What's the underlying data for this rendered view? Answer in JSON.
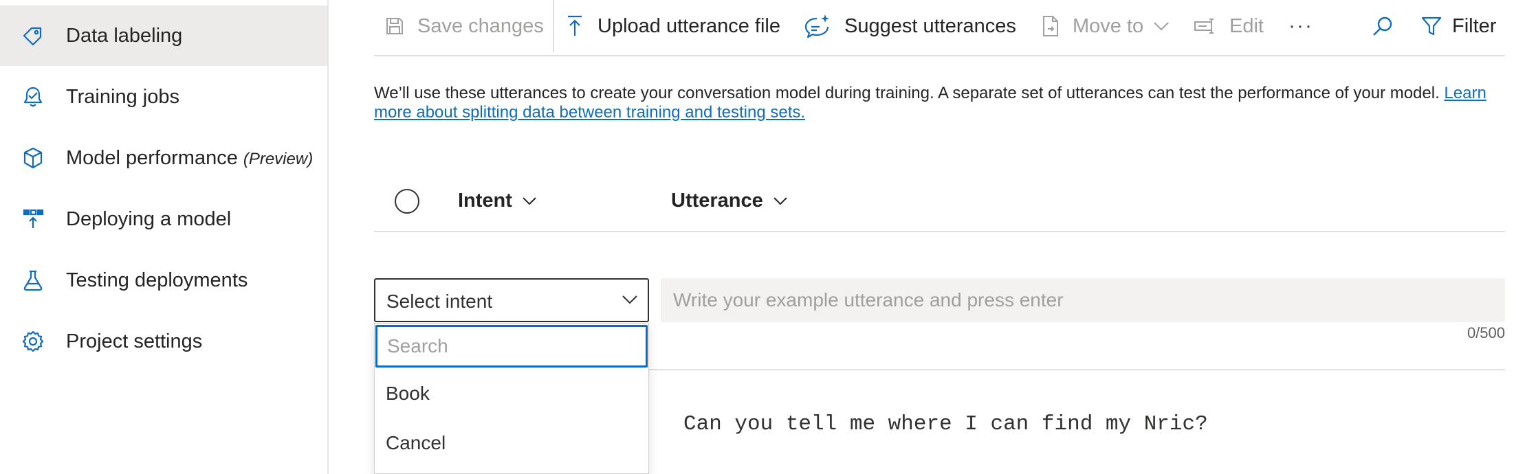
{
  "sidebar": {
    "items": [
      {
        "label": "Data labeling",
        "icon": "tag-icon",
        "active": true
      },
      {
        "label": "Training jobs",
        "icon": "training-icon"
      },
      {
        "label": "Model performance",
        "suffix": "(Preview)",
        "icon": "cube-icon"
      },
      {
        "label": "Deploying a model",
        "icon": "deploy-icon"
      },
      {
        "label": "Testing deployments",
        "icon": "flask-icon"
      },
      {
        "label": "Project settings",
        "icon": "gear-icon"
      }
    ]
  },
  "toolbar": {
    "save_label": "Save changes",
    "upload_label": "Upload utterance file",
    "suggest_label": "Suggest utterances",
    "move_label": "Move to",
    "edit_label": "Edit",
    "more_label": "···",
    "filter_label": "Filter"
  },
  "info": {
    "text": "We’ll use these utterances to create your conversation model during training. A separate set of utterances can test the performance of your model. ",
    "link": "Learn more about splitting data between training and testing sets."
  },
  "table": {
    "col_intent": "Intent",
    "col_utterance": "Utterance"
  },
  "editor": {
    "select_placeholder": "Select intent",
    "utterance_placeholder": "Write your example utterance and press enter",
    "counter": "0/500"
  },
  "dropdown": {
    "search_placeholder": "Search",
    "options": [
      "Book",
      "Cancel"
    ]
  },
  "rows": [
    {
      "utterance": "Can you tell me where I can find my Nric?"
    }
  ],
  "colors": {
    "accent": "#0f6cbd",
    "active_bg": "#edebe9",
    "disabled": "#a19f9d"
  }
}
